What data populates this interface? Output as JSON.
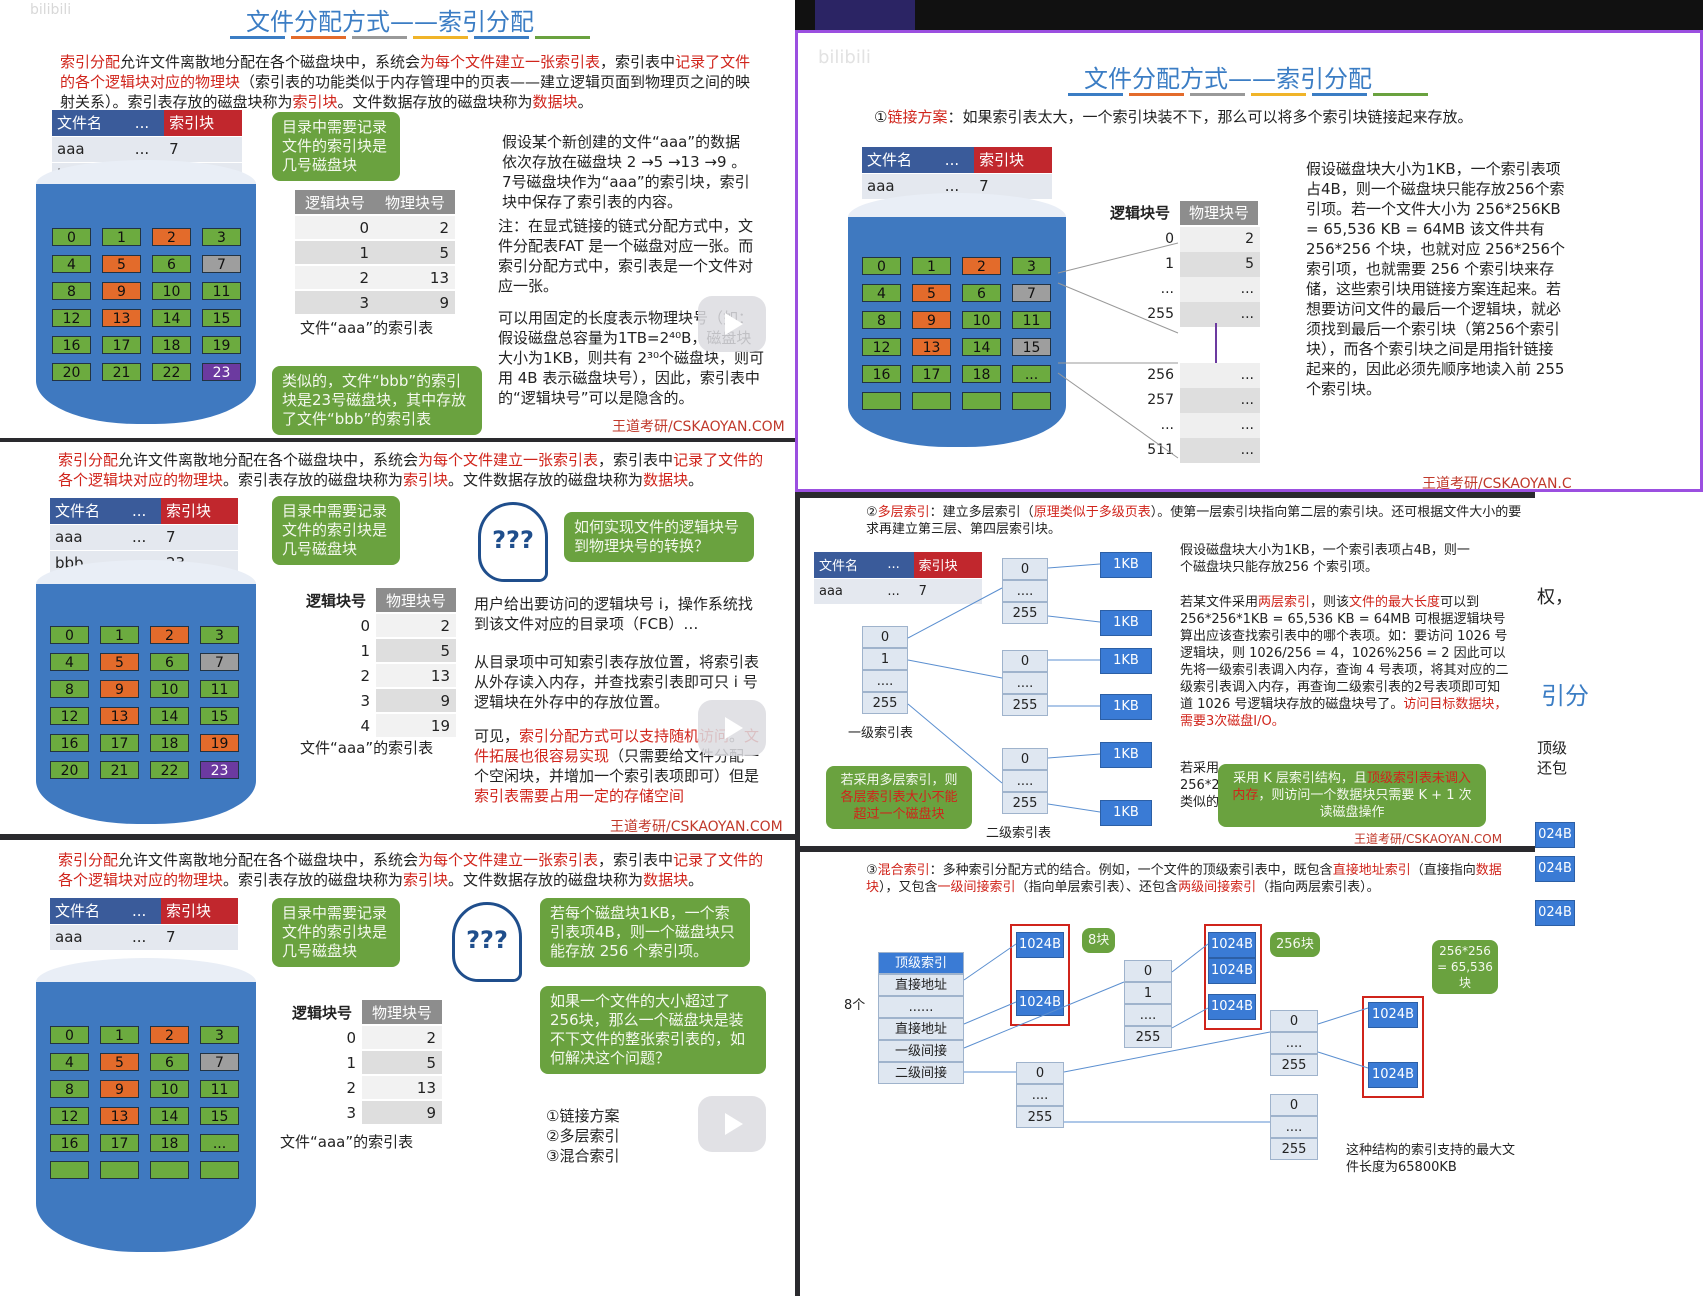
{
  "s1": {
    "title": "文件分配方式——索引分配",
    "intro": [
      [
        "索引分配",
        1
      ],
      [
        "允许文件离散地分配在各个磁盘块中，系统会",
        0
      ],
      [
        "为每个文件建立一张索引表",
        1
      ],
      [
        "，索引表中",
        0
      ],
      [
        "记录了文件的各个逻辑块对应的物理块",
        1
      ],
      [
        "（索引表的功能类似于内存管理中的页表——建立逻辑页面到物理页之间的映射关系）。索引表存放的磁盘块称为",
        0
      ],
      [
        "索引块",
        1
      ],
      [
        "。文件数据存放的磁盘块称为",
        0
      ],
      [
        "数据块",
        1
      ],
      [
        "。",
        0
      ]
    ],
    "dir": {
      "h": [
        "文件名",
        "...",
        "索引块"
      ],
      "rows": [
        [
          "aaa",
          "...",
          "7"
        ],
        [
          "bbb",
          "...",
          "23"
        ]
      ]
    },
    "bub1": "目录中需要记录文件的索引块是几号磁盘块",
    "bub2": "类似的，文件“bbb”的索引块是23号磁盘块，其中存放了文件“bbb”的索引表",
    "ltab": {
      "h": [
        "逻辑块号",
        "物理块号"
      ],
      "rows": [
        [
          "0",
          "2"
        ],
        [
          "1",
          "5"
        ],
        [
          "2",
          "13"
        ],
        [
          "3",
          "9"
        ]
      ],
      "cap": "文件“aaa”的索引表"
    },
    "p1": "假设某个新创建的文件“aaa”的数据依次存放在磁盘块 2 →5 →13 →9 。7号磁盘块作为“aaa”的索引块，索引块中保存了索引表的内容。",
    "p2": "注：在显式链接的链式分配方式中，文件分配表FAT 是一个磁盘对应一张。而索引分配方式中，索引表是一个文件对应一张。",
    "p3": "可以用固定的长度表示物理块号（如：假设磁盘总容量为1TB=2⁴⁰B，磁盘块大小为1KB，则共有 2³⁰个磁盘块，则可用 4B 表示磁盘块号），因此，索引表中的“逻辑块号”可以是隐含的。",
    "foot": "王道考研/CSKAOYAN.COM"
  },
  "s2": {
    "intro": [
      [
        "索引分配",
        1
      ],
      [
        "允许文件离散地分配在各个磁盘块中，系统会",
        0
      ],
      [
        "为每个文件建立一张索引表",
        1
      ],
      [
        "，索引表中",
        0
      ],
      [
        "记录了文件的各个逻辑块对应的物理块",
        1
      ],
      [
        "。索引表存放的磁盘块称为",
        0
      ],
      [
        "索引块",
        1
      ],
      [
        "。文件数据存放的磁盘块称为",
        0
      ],
      [
        "数据块",
        1
      ],
      [
        "。",
        0
      ]
    ],
    "dir": {
      "h": [
        "文件名",
        "...",
        "索引块"
      ],
      "rows": [
        [
          "aaa",
          "...",
          "7"
        ],
        [
          "bbb",
          "...",
          "23"
        ]
      ]
    },
    "bub1": "目录中需要记录文件的索引块是几号磁盘块",
    "bub2": "如何实现文件的逻辑块号到物理块号的转换？",
    "ltab": {
      "h": [
        "逻辑块号",
        "物理块号"
      ],
      "rows": [
        [
          "0",
          "2"
        ],
        [
          "1",
          "5"
        ],
        [
          "2",
          "13"
        ],
        [
          "3",
          "9"
        ],
        [
          "4",
          "19"
        ]
      ],
      "cap": "文件“aaa”的索引表"
    },
    "p1": "用户给出要访问的逻辑块号 i，操作系统找到该文件对应的目录项（FCB）…",
    "p2": "从目录项中可知索引表存放位置，将索引表从外存读入内存，并查找索引表即可只 i 号逻辑块在外存中的存放位置。",
    "p3": [
      [
        "可见，",
        0
      ],
      [
        "索引分配方式可以支持随机访问",
        1
      ],
      [
        "。",
        0
      ],
      [
        "文件拓展也很容易实现",
        1
      ],
      [
        "（只需要给文件分配一个空闲块，并增加一个索引表项即可）但是",
        0
      ],
      [
        "索引表需要占用一定的存储空间",
        1
      ]
    ],
    "foot": "王道考研/CSKAOYAN.COM"
  },
  "s3": {
    "intro": [
      [
        "索引分配",
        1
      ],
      [
        "允许文件离散地分配在各个磁盘块中，系统会",
        0
      ],
      [
        "为每个文件建立一张索引表",
        1
      ],
      [
        "，索引表中",
        0
      ],
      [
        "记录了文件的各个逻辑块对应的物理块",
        1
      ],
      [
        "。索引表存放的磁盘块称为",
        0
      ],
      [
        "索引块",
        1
      ],
      [
        "。文件数据存放的磁盘块称为",
        0
      ],
      [
        "数据块",
        1
      ],
      [
        "。",
        0
      ]
    ],
    "dir": {
      "h": [
        "文件名",
        "...",
        "索引块"
      ],
      "rows": [
        [
          "aaa",
          "...",
          "7"
        ]
      ]
    },
    "bub1": "目录中需要记录文件的索引块是几号磁盘块",
    "bub2": "若每个磁盘块1KB，一个索引表项4B，则一个磁盘块只能存放 256 个索引项。",
    "bub3": "如果一个文件的大小超过了256块，那么一个磁盘块是装不下文件的整张索引表的，如何解决这个问题？",
    "ltab": {
      "h": [
        "逻辑块号",
        "物理块号"
      ],
      "rows": [
        [
          "0",
          "2"
        ],
        [
          "1",
          "5"
        ],
        [
          "2",
          "13"
        ],
        [
          "3",
          "9"
        ]
      ],
      "cap": "文件“aaa”的索引表"
    },
    "list": [
      "①链接方案",
      "②多层索引",
      "③混合索引"
    ]
  },
  "s4": {
    "title": "文件分配方式——索引分配",
    "intro": [
      [
        "①",
        0
      ],
      [
        "链接方案",
        1
      ],
      [
        "：如果索引表太大，一个索引块装不下，那么可以将多个索引块链接起来存放。",
        0
      ]
    ],
    "dir": {
      "h": [
        "文件名",
        "...",
        "索引块"
      ],
      "rows": [
        [
          "aaa",
          "...",
          "7"
        ]
      ]
    },
    "lh": [
      "逻辑块号",
      "物理块号"
    ],
    "idx1": [
      [
        "0",
        "2"
      ],
      [
        "1",
        "5"
      ],
      [
        "...",
        "..."
      ],
      [
        "255",
        "..."
      ]
    ],
    "idx2": [
      [
        "256",
        "..."
      ],
      [
        "257",
        "..."
      ],
      [
        "...",
        "..."
      ],
      [
        "511",
        "..."
      ]
    ],
    "text": "假设磁盘块大小为1KB，一个索引表项占4B，则一个磁盘块只能存放256个索引项。若一个文件大小为 256*256KB = 65,536 KB = 64MB 该文件共有 256*256 个块，也就对应 256*256个索引项，也就需要 256 个索引块来存储，这些索引块用链接方案连起来。若想要访问文件的最后一个逻辑块，就必须找到最后一个索引块（第256个索引块），而各个索引块之间是用指针链接起来的，因此必须先顺序地读入前 255 个索引块。",
    "foot": "王道考研/CSKAOYAN.C"
  },
  "s5": {
    "intro": [
      [
        "②",
        0
      ],
      [
        "多层索引",
        1
      ],
      [
        "：建立多层索引（",
        0
      ],
      [
        "原理类似于多级页表",
        1
      ],
      [
        "）。使第一层索引块指向第二层的索引块。还可根据文件大小的要求再建立第三层、第四层索引块。",
        0
      ]
    ],
    "dir": {
      "h": [
        "文件名",
        "...",
        "索引块"
      ],
      "rows": [
        [
          "aaa",
          "...",
          "7"
        ]
      ]
    },
    "l1": [
      "0",
      "1",
      "....",
      "255"
    ],
    "l1cap": "一级索引表",
    "l2cap": "二级索引表",
    "kb": "1KB",
    "cells": [
      "0",
      "....",
      "255"
    ],
    "t1": "假设磁盘块大小为1KB，一个索引表项占4B，则一个磁盘块只能存放256 个索引项。",
    "t2": [
      [
        "若某文件采用",
        0
      ],
      [
        "两层索引",
        1
      ],
      [
        "，则该",
        0
      ],
      [
        "文件的最大长度",
        1
      ],
      [
        "可以到 256*256*1KB = 65,536 KB = 64MB 可根据逻辑块号算出应该查找索引表中的哪个表项。如：要访问 1026 号逻辑块，则 1026/256 = 4，1026%256 = 2 因此可以先将一级索引表调入内存，查询 4 号表项，将其对应的二级索引表调入内存，再查询二级索引表的2号表项即可知道 1026 号逻辑块存放的磁盘块号了。",
        0
      ],
      [
        "访问目标数据块，需要3次磁盘I/O。",
        1
      ]
    ],
    "t3": "若采用 256*2 类似的",
    "bubL": [
      [
        "若采用多层索引，则",
        0
      ],
      [
        "各层索引表大小不能超过一个磁盘块",
        1
      ]
    ],
    "bubR": [
      [
        "采用 K 层索引结构，且",
        0
      ],
      [
        "顶级索引表未调入内存",
        1
      ],
      [
        "，则访问一个数据块只需要 K + 1 次读磁盘操作",
        0
      ]
    ],
    "foot": "王道考研/CSKAOYAN.COM"
  },
  "s6": {
    "intro": [
      [
        "③",
        0
      ],
      [
        "混合索引",
        1
      ],
      [
        "：多种索引分配方式的结合。例如，一个文件的顶级索引表中，既包含",
        0
      ],
      [
        "直接地址索引",
        1
      ],
      [
        "（直接指向",
        0
      ],
      [
        "数据块",
        1
      ],
      [
        "），又包含",
        0
      ],
      [
        "一级间接索引",
        1
      ],
      [
        "（指向单层索引表）、还包含",
        0
      ],
      [
        "两级间接索引",
        1
      ],
      [
        "（指向两层索引表）。",
        0
      ]
    ],
    "top": [
      "顶级索引",
      "直接地址",
      "......",
      "直接地址",
      "一级间接",
      "二级间接"
    ],
    "eight": "8个",
    "b": "1024B",
    "c8": "8块",
    "c256": "256块",
    "c65": "256*256 = 65,536 块",
    "cells": [
      "0",
      "1",
      "....",
      "255"
    ],
    "cells2": [
      "0",
      "....",
      "255"
    ],
    "note": "这种结构的索引支持的最大文件长度为65800KB"
  },
  "right": {
    "a": "权，",
    "b": "引分",
    "c": "顶级",
    "d": "还包",
    "e": "024B"
  }
}
